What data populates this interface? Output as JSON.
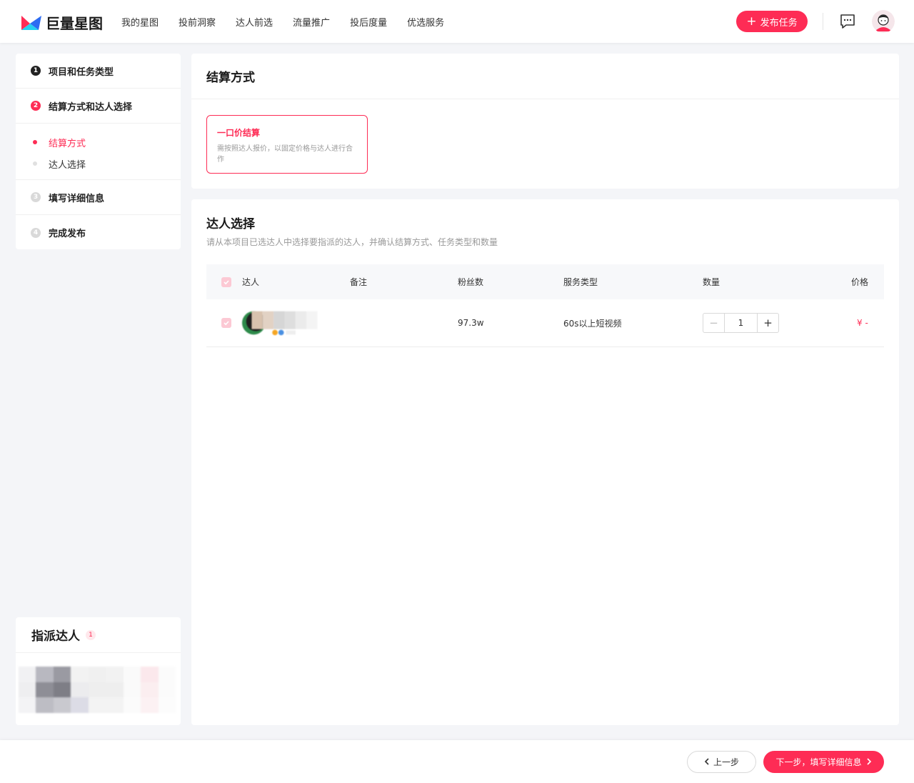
{
  "header": {
    "logo_text": "巨量星图",
    "nav": [
      "我的星图",
      "投前洞察",
      "达人前选",
      "流量推广",
      "投后度量",
      "优选服务"
    ],
    "publish_label": "发布任务"
  },
  "steps": [
    {
      "num": "1",
      "label": "项目和任务类型",
      "state": "done"
    },
    {
      "num": "2",
      "label": "结算方式和达人选择",
      "state": "active"
    },
    {
      "num": "3",
      "label": "填写详细信息",
      "state": "todo"
    },
    {
      "num": "4",
      "label": "完成发布",
      "state": "todo"
    }
  ],
  "substeps": [
    {
      "label": "结算方式",
      "state": "active"
    },
    {
      "label": "达人选择",
      "state": "inactive"
    }
  ],
  "assign": {
    "title": "指派达人",
    "count": "1"
  },
  "settlement": {
    "title": "结算方式",
    "option_title": "一口价结算",
    "option_desc": "需按照达人报价，以固定价格与达人进行合作"
  },
  "selection": {
    "title": "达人选择",
    "subtitle": "请从本项目已选达人中选择要指派的达人，并确认结算方式、任务类型和数量",
    "columns": [
      "达人",
      "备注",
      "粉丝数",
      "服务类型",
      "数量",
      "价格"
    ],
    "rows": [
      {
        "fans": "97.3w",
        "service": "60s以上短视频",
        "quantity": "1",
        "price": "¥ -"
      }
    ]
  },
  "footer": {
    "prev_label": "上一步",
    "next_label": "下一步，填写详细信息"
  },
  "colors": {
    "accent": "#fe2c55",
    "background": "#f4f5f8"
  }
}
